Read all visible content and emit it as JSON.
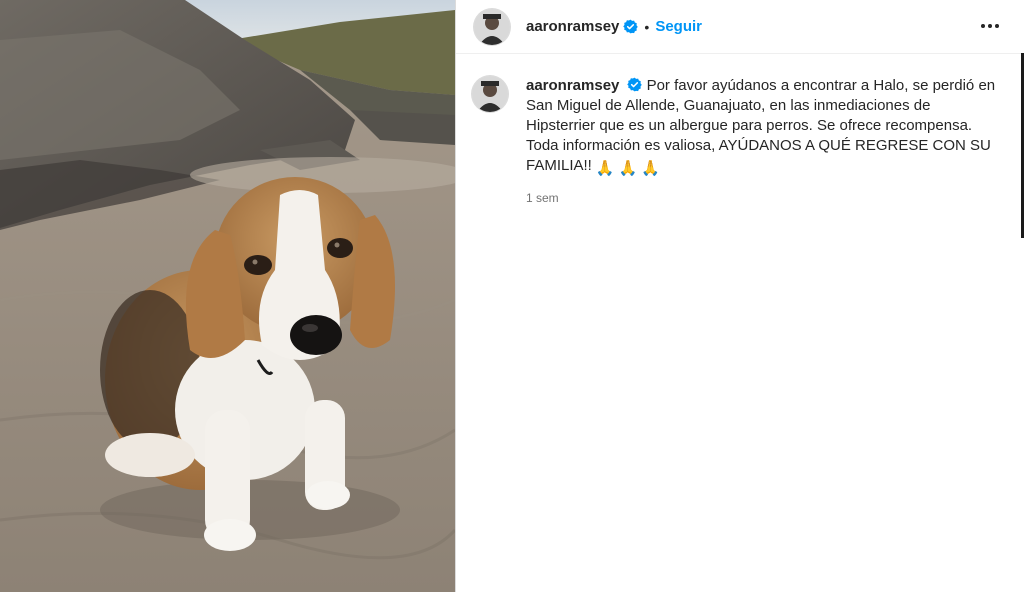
{
  "post": {
    "photo_alt": "beagle-on-beach",
    "colors": {
      "link_blue": "#0095f6",
      "verified_blue": "#0095f6",
      "muted_text": "#737373"
    }
  },
  "header": {
    "username": "aaronramsey",
    "separator": "•",
    "follow_label": "Seguir",
    "more_icon": "more-options-icon"
  },
  "caption": {
    "username": "aaronramsey",
    "text": "Por favor ayúdanos a encontrar a Halo, se perdió en San Miguel de Allende, Guanajuato, en las inmediaciones de Hipsterrier que es un albergue para perros. Se ofrece recompensa.\nToda información es valiosa, AYÚDANOS A QUÉ REGRESE CON SU FAMILIA!!",
    "emojis": [
      "🙏",
      "🙏",
      "🙏"
    ],
    "timestamp": "1 sem"
  }
}
